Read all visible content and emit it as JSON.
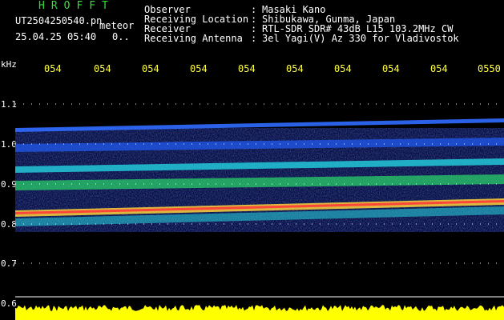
{
  "header": {
    "brand": "HROFFT",
    "filename": "UT2504250540.pn",
    "tag": "meteor",
    "datetime": "25.04.25 05:40",
    "extra": "0..",
    "info": [
      {
        "label": "Observer",
        "value": "Masaki Kano"
      },
      {
        "label": "Receiving Location",
        "value": "Shibukawa, Gunma, Japan"
      },
      {
        "label": "Receiver",
        "value": "RTL-SDR SDR# 43dB L15 103.2MHz CW"
      },
      {
        "label": "Receiving Antenna",
        "value": "3el Yagi(V) Az 330 for Vladivostok"
      }
    ]
  },
  "axis": {
    "unit": "kHz",
    "time_labels": [
      "054",
      "054",
      "054",
      "054",
      "054",
      "054",
      "054",
      "054",
      "054",
      "0550"
    ],
    "freq_labels": [
      "1.1",
      "1.0",
      "0.9",
      "0.8",
      "0.7",
      "0.6"
    ]
  },
  "colors": {
    "grid": "#ffffff",
    "axis_label": "#ffff44",
    "brand": "#33dd33",
    "amplitude": "#ffff00"
  }
}
